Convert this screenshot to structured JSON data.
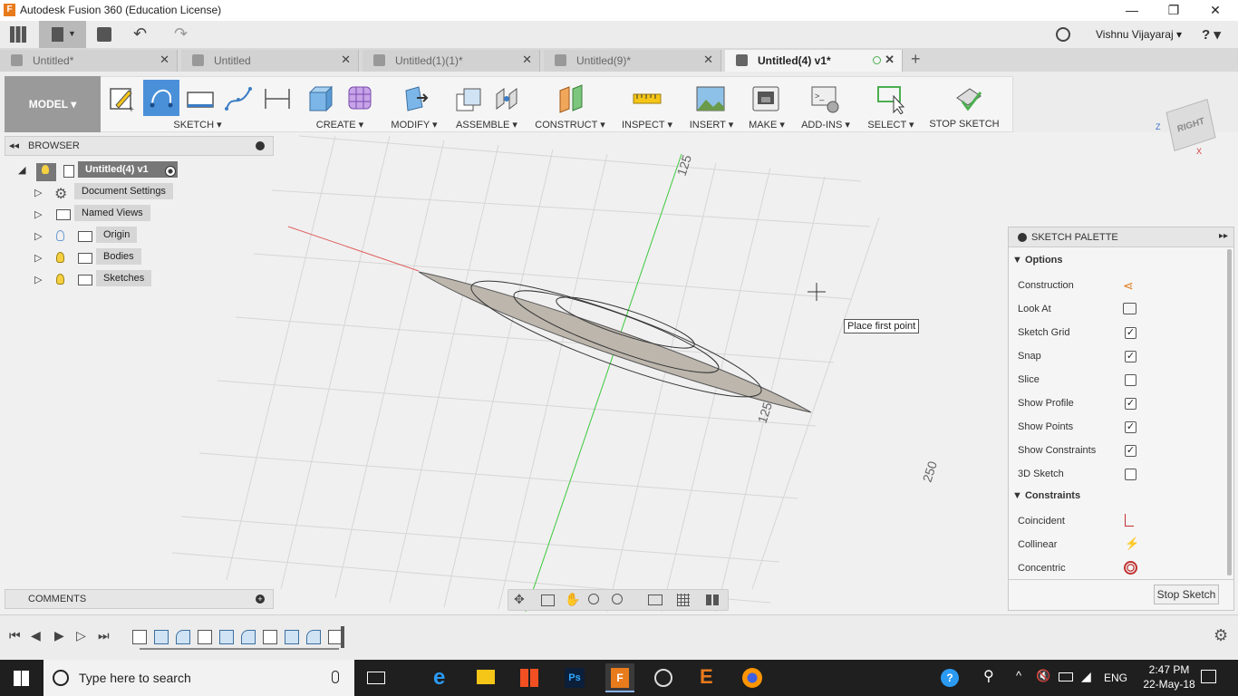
{
  "window": {
    "title": "Autodesk Fusion 360 (Education License)",
    "minimize": "—",
    "restore": "❐",
    "close": "✕"
  },
  "appbar": {
    "user": "Vishnu Vijayaraj ▾",
    "help": "? ▾"
  },
  "tabs": [
    {
      "label": "Untitled*",
      "close": "✕"
    },
    {
      "label": "Untitled",
      "close": "✕"
    },
    {
      "label": "Untitled(1)(1)*",
      "close": "✕"
    },
    {
      "label": "Untitled(9)*",
      "close": "✕"
    },
    {
      "label": "Untitled(4) v1*",
      "close": "✕"
    }
  ],
  "new_tab": "+",
  "toolbar": {
    "workspace": "MODEL ▾",
    "groups": [
      "SKETCH ▾",
      "CREATE ▾",
      "MODIFY ▾",
      "ASSEMBLE ▾",
      "CONSTRUCT ▾",
      "INSPECT ▾",
      "INSERT ▾",
      "MAKE ▾",
      "ADD-INS ▾",
      "SELECT ▾",
      "STOP SKETCH"
    ]
  },
  "viewcube": {
    "face": "RIGHT",
    "axis_z": "Z",
    "axis_x": "X"
  },
  "browser": {
    "title": "BROWSER",
    "root": "Untitled(4) v1",
    "items": [
      "Document Settings",
      "Named Views",
      "Origin",
      "Bodies",
      "Sketches"
    ]
  },
  "comments": {
    "title": "COMMENTS"
  },
  "canvas": {
    "grid_labels": [
      "125",
      "125",
      "250"
    ],
    "tooltip": "Place first point"
  },
  "palette": {
    "title": "SKETCH PALETTE",
    "options_header": "Options",
    "options": [
      {
        "label": "Construction",
        "type": "icon"
      },
      {
        "label": "Look At",
        "type": "icon"
      },
      {
        "label": "Sketch Grid",
        "checked": true
      },
      {
        "label": "Snap",
        "checked": true
      },
      {
        "label": "Slice",
        "checked": false
      },
      {
        "label": "Show Profile",
        "checked": true
      },
      {
        "label": "Show Points",
        "checked": true
      },
      {
        "label": "Show Constraints",
        "checked": true
      },
      {
        "label": "3D Sketch",
        "checked": false
      }
    ],
    "constraints_header": "Constraints",
    "constraints": [
      "Coincident",
      "Collinear",
      "Concentric"
    ],
    "stop_button": "Stop Sketch"
  },
  "taskbar": {
    "search_placeholder": "Type here to search",
    "language": "ENG",
    "time": "2:47 PM",
    "date": "22-May-18"
  }
}
